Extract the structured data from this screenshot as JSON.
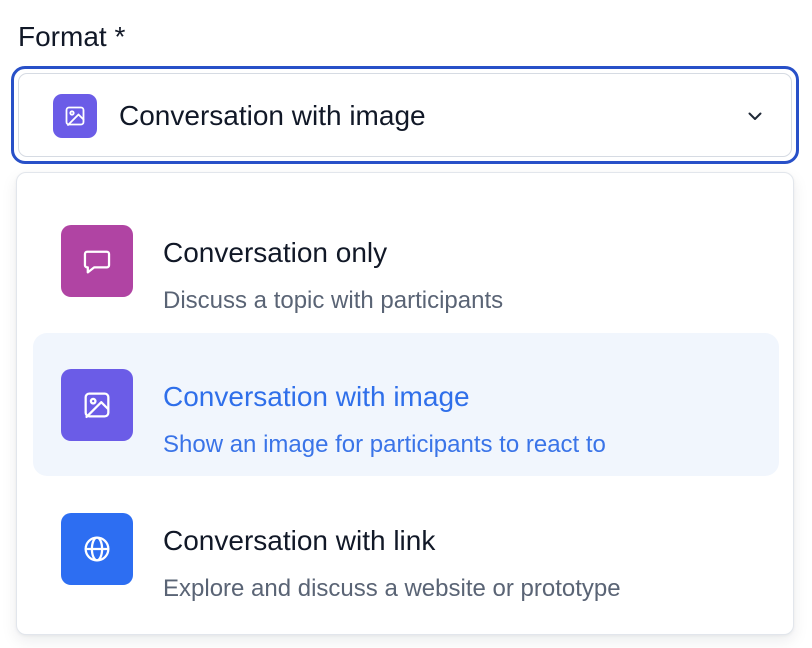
{
  "field": {
    "label": "Format *"
  },
  "select": {
    "value": "Conversation with image",
    "icon": "image-icon",
    "chevron_icon": "chevron-down-icon"
  },
  "colors": {
    "focus_ring": "#2850c8",
    "selected_text": "#2f6fea",
    "selected_bg": "#f1f6fd",
    "option_conversation_only": "#b044a3",
    "option_conversation_image": "#6b5ce7",
    "option_conversation_link": "#2d6ef2"
  },
  "options": [
    {
      "title": "Conversation only",
      "description": "Discuss a topic with participants",
      "icon": "chat-bubble-icon",
      "selected": false
    },
    {
      "title": "Conversation with image",
      "description": "Show an image for participants to react to",
      "icon": "image-icon",
      "selected": true
    },
    {
      "title": "Conversation with link",
      "description": "Explore and discuss a website or prototype",
      "icon": "globe-icon",
      "selected": false
    }
  ]
}
